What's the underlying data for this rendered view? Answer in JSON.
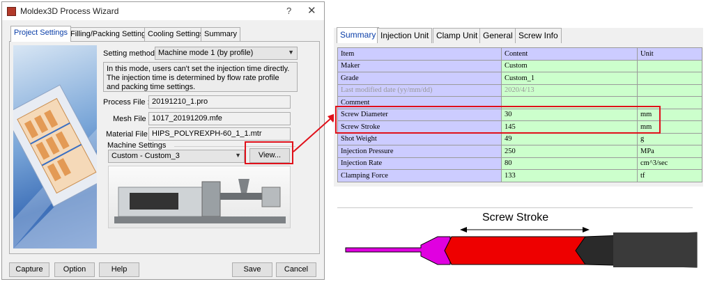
{
  "wizard": {
    "title": "Moldex3D Process Wizard",
    "help_glyph": "?",
    "close_glyph": "✕",
    "tabs": [
      "Project Settings",
      "Filling/Packing Settings",
      "Cooling Settings",
      "Summary"
    ],
    "setting_method_label": "Setting method :",
    "setting_method_value": "Machine mode 1 (by profile)",
    "info_text": "In this mode, users can't set the injection time directly. The injection time is determined by flow rate profile and packing time settings.",
    "process_file_label": "Process File :",
    "process_file_value": "20191210_1.pro",
    "mesh_file_label": "Mesh File :",
    "mesh_file_value": "1017_20191209.mfe",
    "material_file_label": "Material File :",
    "material_file_value": "HIPS_POLYREXPH-60_1_1.mtr",
    "machine_settings_label": "Machine Settings",
    "machine_value": "Custom - Custom_3",
    "view_button": "View...",
    "footer_buttons": {
      "capture": "Capture",
      "option": "Option",
      "help": "Help",
      "save": "Save",
      "cancel": "Cancel"
    }
  },
  "machine_table": {
    "tabs": [
      "Summary",
      "Injection Unit",
      "Clamp Unit",
      "General",
      "Screw Info"
    ],
    "header": [
      "Item",
      "Content",
      "Unit"
    ],
    "rows": [
      [
        "Maker",
        "Custom",
        ""
      ],
      [
        "Grade",
        "Custom_1",
        ""
      ],
      [
        "Last modified date (yy/mm/dd)",
        "2020/4/13",
        ""
      ],
      [
        "Comment",
        "",
        ""
      ],
      [
        "Screw Diameter",
        "30",
        "mm"
      ],
      [
        "Screw Stroke",
        "145",
        "mm"
      ],
      [
        "Shot Weight",
        "49",
        "g"
      ],
      [
        "Injection Pressure",
        "250",
        "MPa"
      ],
      [
        "Injection Rate",
        "80",
        "cm^3/sec"
      ],
      [
        "Clamping Force",
        "133",
        "tf"
      ]
    ]
  },
  "diagram": {
    "screw_stroke_label": "Screw Stroke",
    "colors": {
      "nozzle": "#e000e0",
      "melt": "#ee0000",
      "screw": "#2a2a2a",
      "highlight": "#e0101a"
    }
  }
}
